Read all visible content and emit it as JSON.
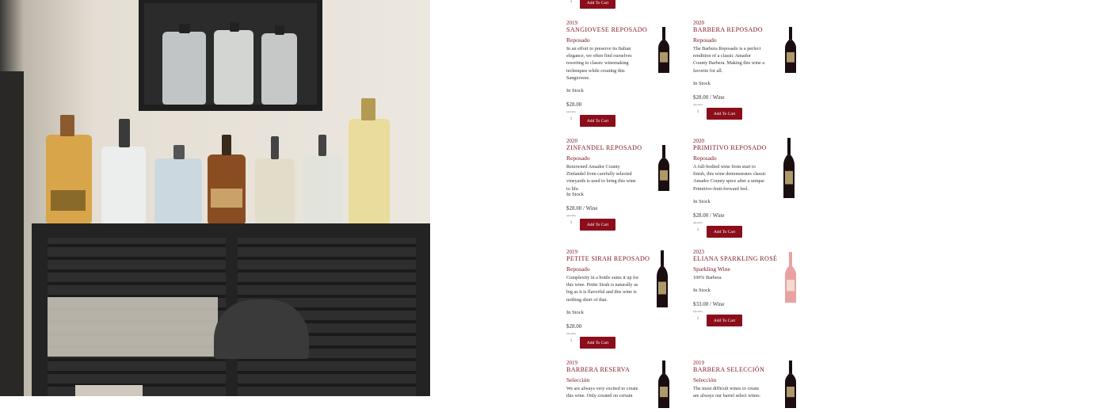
{
  "photo": {
    "alt_icon": "photo-icon"
  },
  "top": {
    "qty": "1",
    "button": "Add To Cart"
  },
  "common": {
    "quantity_label": "Quantity",
    "add_button": "Add To Cart"
  },
  "products": [
    {
      "year": "2019",
      "name": "SANGIOVESE REPOSADO",
      "type": "Reposado",
      "desc": "In an effort to preserve its Italian elegance, we often find ourselves resorting to classic winemaking techniques while creating this Sangiovese.",
      "stock": "In Stock",
      "price": "$28.00",
      "qty": "1",
      "bottle_color": "#1a0e10",
      "label_color": "#c9b27a"
    },
    {
      "year": "2020",
      "name": "BARBERA REPOSADO",
      "type": "Reposado",
      "desc": "The Barbera Reposado is a perfect rendition of a classic Amador County Barbera. Making this wine a favorite for all.",
      "stock": "In Stock",
      "price": "$28.00 / Wine",
      "qty": "1",
      "bottle_color": "#1a0e10",
      "label_color": "#c9b27a"
    },
    {
      "year": "2020",
      "name": "ZINFANDEL REPOSADO",
      "type": "Reposado",
      "desc": "Renowned Amador County Zinfandel from carefully selected vineyards is used to bring this wine to life.",
      "stock": "In Stock",
      "price": "$28.00 / Wine",
      "qty": "1",
      "bottle_color": "#1a0e10",
      "label_color": "#c9b27a"
    },
    {
      "year": "2020",
      "name": "PRIMITIVO REPOSADO",
      "type": "Reposado",
      "desc": "A full-bodied wine from start to finish, this wine demonstrates classic Amador County spice after a unique Primitivo-fruit-forward feel.",
      "stock": "In Stock",
      "price": "$28.00 / Wine",
      "qty": "1",
      "bottle_color": "#1a0e10",
      "label_color": "#c9b27a"
    },
    {
      "year": "2019",
      "name": "PETITE SIRAH REPOSADO",
      "type": "Reposado",
      "desc": "Complexity in a bottle sums it up for this wine. Petite Sirah is naturally as big as it is flavorful and this wine is nothing short of that.",
      "stock": "In Stock",
      "price": "$28.00",
      "qty": "1",
      "bottle_color": "#1a0e10",
      "label_color": "#c9b27a"
    },
    {
      "year": "2023",
      "name": "ELIANA SPARKLING ROSÉ",
      "type": "Sparkling Wine",
      "desc": "100% Barbera",
      "stock": "In Stock",
      "price": "$33.00 / Wine",
      "qty": "1",
      "bottle_color": "#e9a2a0",
      "label_color": "#f3e6d8"
    },
    {
      "year": "2019",
      "name": "BARBERA RESERVA",
      "type": "Selección",
      "desc": "We are always very excited to create this wine. Only created on certain",
      "stock": "",
      "price": "",
      "qty": "",
      "bottle_color": "#1a0e10",
      "label_color": "#c9b27a"
    },
    {
      "year": "2019",
      "name": "BARBERA SELECCIÓN",
      "type": "Selección",
      "desc": "The most difficult wines to create are always our barrel select wines.",
      "stock": "",
      "price": "",
      "qty": "",
      "bottle_color": "#1a0e10",
      "label_color": "#c9b27a"
    }
  ]
}
